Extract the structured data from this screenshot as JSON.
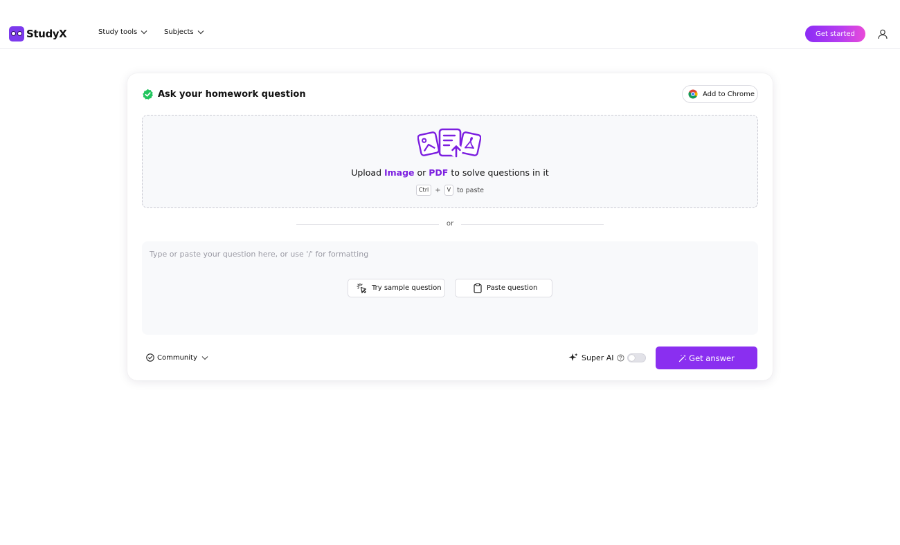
{
  "brand": {
    "name": "StudyX"
  },
  "nav": [
    {
      "label": "Study tools"
    },
    {
      "label": "Subjects"
    }
  ],
  "header": {
    "cta_label": "Get started"
  },
  "card": {
    "title": "Ask your homework question",
    "chrome_label": "Add to Chrome",
    "upload": {
      "prefix": "Upload ",
      "image_word": "Image",
      "or_word": " or ",
      "pdf_word": "PDF",
      "suffix": " to solve questions in it",
      "key_ctrl": "Ctrl",
      "key_plus": "+",
      "key_v": "V",
      "paste_hint": "to paste"
    },
    "divider_label": "or",
    "question": {
      "placeholder": "Type or paste your question here, or use '/' for formatting",
      "sample_label": "Try sample question",
      "paste_label": "Paste question"
    },
    "footer": {
      "community_label": "Community",
      "super_ai_label": "Super AI",
      "super_ai_enabled": false,
      "get_answer_label": "Get answer"
    }
  },
  "colors": {
    "accent": "#8a2ff0",
    "highlight": "#7c1fe0",
    "check_green": "#22c55e"
  },
  "icons": {
    "check": "check-circle-icon",
    "chrome": "chrome-icon",
    "upload": "upload-files-icon",
    "cursor": "cursor-click-icon",
    "clipboard": "clipboard-icon",
    "sparkle": "sparkle-icon",
    "wand": "magic-wand-icon",
    "user": "user-icon"
  }
}
